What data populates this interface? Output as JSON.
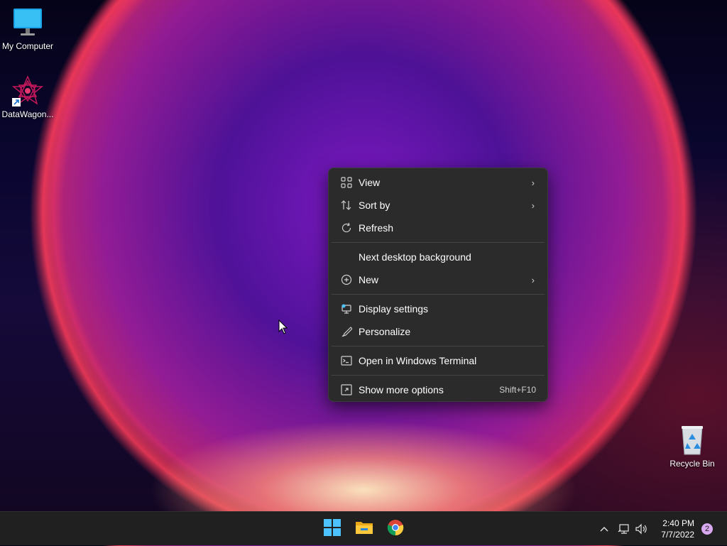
{
  "desktop": {
    "icons": [
      {
        "label": "My Computer",
        "icon": "monitor-icon"
      },
      {
        "label": "DataWagon...",
        "icon": "datawagon-shortcut-icon"
      },
      {
        "label": "Recycle Bin",
        "icon": "recycle-bin-icon"
      }
    ]
  },
  "context_menu": {
    "items": [
      {
        "label": "View",
        "icon": "grid-icon",
        "submenu": true
      },
      {
        "label": "Sort by",
        "icon": "sort-icon",
        "submenu": true
      },
      {
        "label": "Refresh",
        "icon": "refresh-icon"
      },
      {
        "label": "Next desktop background",
        "icon": ""
      },
      {
        "label": "New",
        "icon": "plus-circle-icon",
        "submenu": true
      },
      {
        "label": "Display settings",
        "icon": "display-settings-icon"
      },
      {
        "label": "Personalize",
        "icon": "brush-icon"
      },
      {
        "label": "Open in Windows Terminal",
        "icon": "terminal-icon"
      },
      {
        "label": "Show more options",
        "icon": "expand-icon",
        "shortcut": "Shift+F10"
      }
    ]
  },
  "taskbar": {
    "apps": [
      {
        "name": "start-button",
        "icon": "windows-logo-icon"
      },
      {
        "name": "file-explorer",
        "icon": "folder-icon"
      },
      {
        "name": "chrome",
        "icon": "chrome-icon"
      }
    ],
    "clock": {
      "time": "2:40 PM",
      "date": "7/7/2022"
    },
    "notification_count": "2",
    "colors": {
      "accent": "#4cc2ff",
      "taskbar": "#202020",
      "menu": "#2b2b2b"
    }
  }
}
